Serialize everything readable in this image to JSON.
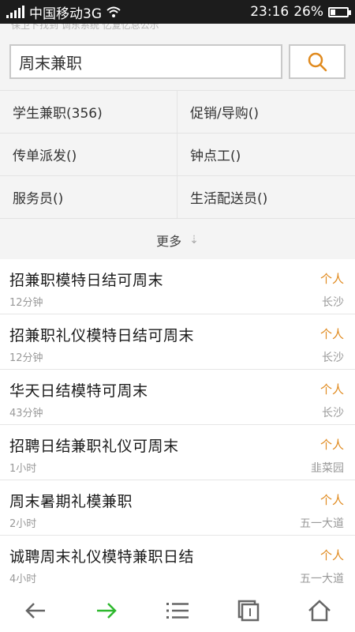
{
  "status_bar": {
    "carrier": "中国移动3G",
    "time": "23:16",
    "battery": "26%"
  },
  "notice": "保卫卜找到 调东系统 忆复忆总公示",
  "search": {
    "value": "周末兼职"
  },
  "categories": [
    {
      "left": "学生兼职(356)",
      "right": "促销/导购()"
    },
    {
      "left": "传单派发()",
      "right": "钟点工()"
    },
    {
      "left": "服务员()",
      "right": "生活配送员()"
    }
  ],
  "more_label": "更多",
  "jobs": [
    {
      "title": "招兼职模特日结可周末",
      "time": "12分钟",
      "type": "个人",
      "location": "长沙"
    },
    {
      "title": "招兼职礼仪模特日结可周末",
      "time": "12分钟",
      "type": "个人",
      "location": "长沙"
    },
    {
      "title": "华天日结模特可周末",
      "time": "43分钟",
      "type": "个人",
      "location": "长沙"
    },
    {
      "title": "招聘日结兼职礼仪可周末",
      "time": "1小时",
      "type": "个人",
      "location": "韭菜园"
    },
    {
      "title": "周末暑期礼模兼职",
      "time": "2小时",
      "type": "个人",
      "location": "五一大道"
    },
    {
      "title": "诚聘周末礼仪模特兼职日结",
      "time": "4小时",
      "type": "个人",
      "location": "五一大道"
    }
  ],
  "colors": {
    "accent_orange": "#e08a1e",
    "nav_active_green": "#2eb82e",
    "statusbar_bg": "#1c1c1c"
  },
  "icons": [
    "back-arrow-icon",
    "forward-arrow-icon",
    "menu-icon",
    "tabs-icon",
    "home-icon",
    "search-icon"
  ]
}
